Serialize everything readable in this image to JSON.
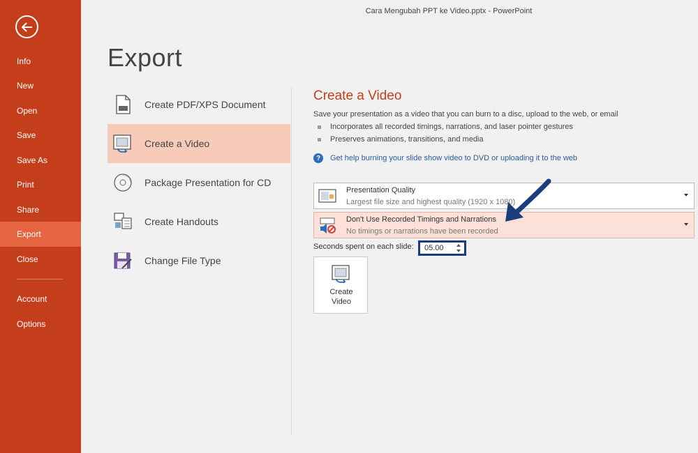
{
  "window": {
    "title": "Cara Mengubah PPT ke Video.pptx - PowerPoint"
  },
  "sidebar": {
    "back_icon": "back-arrow-icon",
    "items": [
      {
        "label": "Info"
      },
      {
        "label": "New"
      },
      {
        "label": "Open"
      },
      {
        "label": "Save"
      },
      {
        "label": "Save As"
      },
      {
        "label": "Print"
      },
      {
        "label": "Share"
      },
      {
        "label": "Export",
        "active": true
      },
      {
        "label": "Close"
      },
      {
        "label": "Account"
      },
      {
        "label": "Options"
      }
    ]
  },
  "page": {
    "title": "Export"
  },
  "export_options": [
    {
      "label": "Create PDF/XPS Document",
      "icon": "pdf-document-icon"
    },
    {
      "label": "Create a Video",
      "icon": "video-icon",
      "active": true
    },
    {
      "label": "Package Presentation for CD",
      "icon": "cd-icon"
    },
    {
      "label": "Create Handouts",
      "icon": "handouts-icon"
    },
    {
      "label": "Change File Type",
      "icon": "file-type-icon"
    }
  ],
  "panel": {
    "title": "Create a Video",
    "description": "Save your presentation as a video that you can burn to a disc, upload to the web, or email",
    "bullets": [
      "Incorporates all recorded timings, narrations, and laser pointer gestures",
      "Preserves animations, transitions, and media"
    ],
    "help_link": "Get help burning your slide show video to DVD or uploading it to the web",
    "help_icon_glyph": "?"
  },
  "quality_dropdown": {
    "title": "Presentation Quality",
    "subtitle": "Largest file size and highest quality (1920 x 1080)"
  },
  "timing_dropdown": {
    "title": "Don't Use Recorded Timings and Narrations",
    "subtitle": "No timings or narrations have been recorded"
  },
  "seconds": {
    "label": "Seconds spent on each slide:",
    "value": "05.00"
  },
  "create_button": {
    "label": "Create\nVideo"
  },
  "colors": {
    "sidebar": "#c43e1c",
    "sidebar_active": "#e4653f",
    "accent": "#c43e1c",
    "selected_option": "#f8cbb9",
    "annotation": "#1d3c7e"
  }
}
